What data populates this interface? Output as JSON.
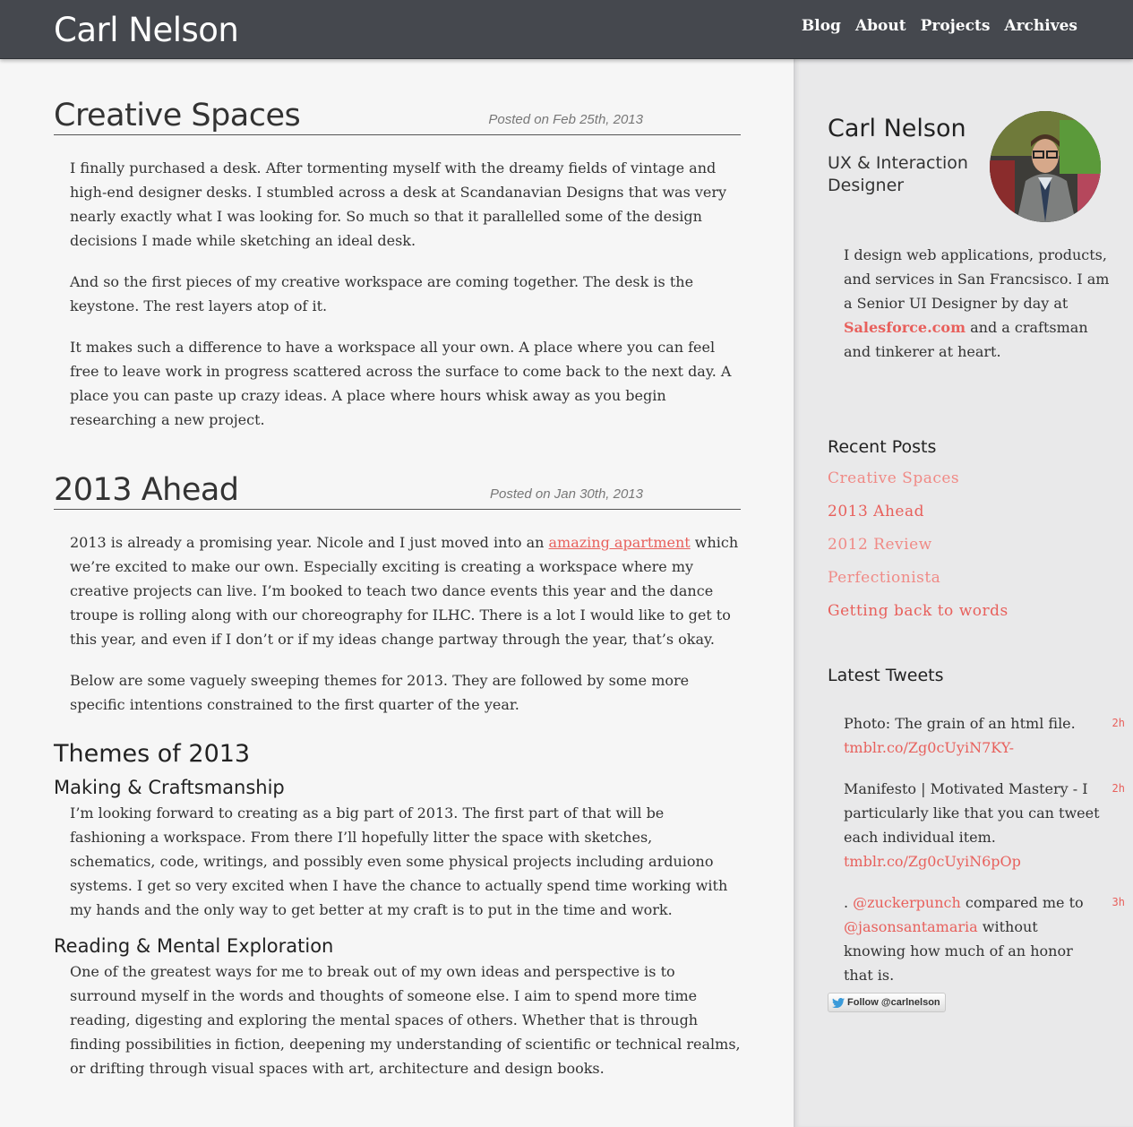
{
  "header": {
    "site_title": "Carl Nelson",
    "nav": [
      "Blog",
      "About",
      "Projects",
      "Archives"
    ]
  },
  "posts": [
    {
      "title": "Creative Spaces",
      "date": "Posted on Feb 25th, 2013",
      "paragraphs": [
        "I finally purchased a desk. After tormenting myself with the dreamy fields of vintage and high-end designer desks. I stumbled across a desk at Scandanavian Designs that was very nearly exactly what I was looking for. So much so that it parallelled some of the design decisions I made while sketching an ideal desk.",
        "And so the first pieces of my creative workspace are coming together. The desk is the keystone. The rest layers atop of it.",
        "It makes such a difference to have a workspace all your own. A place where you can feel free to leave work in progress scattered across the surface to come back to the next day. A place you can paste up crazy ideas. A place where hours whisk away as you begin researching a new project."
      ]
    },
    {
      "title": "2013 Ahead",
      "date": "Posted on Jan 30th, 2013",
      "p1_before": "2013 is already a promising year. Nicole and I just moved into an ",
      "p1_link": "amazing apartment",
      "p1_after": " which we’re excited to make our own. Especially exciting is creating a workspace where my creative projects can live. I’m booked to teach two dance events this year and the dance troupe is rolling along with our choreography for ILHC. There is a lot I would like to get to this year, and even if I don’t or if my ideas change partway through the year, that’s okay.",
      "p2": "Below are some vaguely sweeping themes for 2013. They are followed by some more specific intentions constrained to the first quarter of the year.",
      "section_heading": "Themes of 2013",
      "sub1": "Making & Craftsmanship",
      "sub1_text": "I’m looking forward to creating as a big part of 2013. The first part of that will be fashioning a workspace. From there I’ll hopefully litter the space with sketches, schematics, code, writings, and possibly even some physical projects including arduiono systems. I get so very excited when I have the chance to actually spend time working with my hands and the only way to get better at my craft is to put in the time and work.",
      "sub2": "Reading & Mental Exploration",
      "sub2_text": "One of the greatest ways for me to break out of my own ideas and perspective is to surround myself in the words and thoughts of someone else. I aim to spend more time reading, digesting and exploring the mental spaces of others. Whether that is through finding possibilities in fiction, deepening my understanding of scientific or technical realms, or drifting through visual spaces with art, architecture and design books."
    }
  ],
  "sidebar": {
    "name": "Carl Nelson",
    "role": "UX & Interaction Designer",
    "bio_before": "I design web applications, products, and services in San Francsisco. I am a Senior UI Designer by day at ",
    "bio_link": "Salesforce.com",
    "bio_after": " and a craftsman and tinkerer at heart.",
    "recent_heading": "Recent Posts",
    "recent_posts": [
      {
        "label": "Creative Spaces",
        "color": "#f08a86"
      },
      {
        "label": "2013 Ahead",
        "color": "#e8605c"
      },
      {
        "label": "2012 Review",
        "color": "#f08a86"
      },
      {
        "label": "Perfectionista",
        "color": "#f08a86"
      },
      {
        "label": "Getting back to words",
        "color": "#e8605c"
      }
    ],
    "tweets_heading": "Latest Tweets",
    "tweets": [
      {
        "pre": "Photo: The grain of an html file. ",
        "link": "tmblr.co/Zg0cUyiN7KY-",
        "link2": "",
        "post": "",
        "age": "2h"
      },
      {
        "pre": "Manifesto | Motivated Mastery - I particularly like that you can tweet each individual item. ",
        "link": "tmblr.co/Zg0cUyiN6pOp",
        "link2": "",
        "post": "",
        "age": "2h"
      },
      {
        "pre": ". ",
        "link": "@zuckerpunch",
        "mid": " compared me to ",
        "link2": "@jasonsantamaria",
        "post": " without knowing how much of an honor that is.",
        "age": "3h"
      }
    ],
    "follow_label": "Follow @carlnelson",
    "accent_color": "#e8605c"
  }
}
